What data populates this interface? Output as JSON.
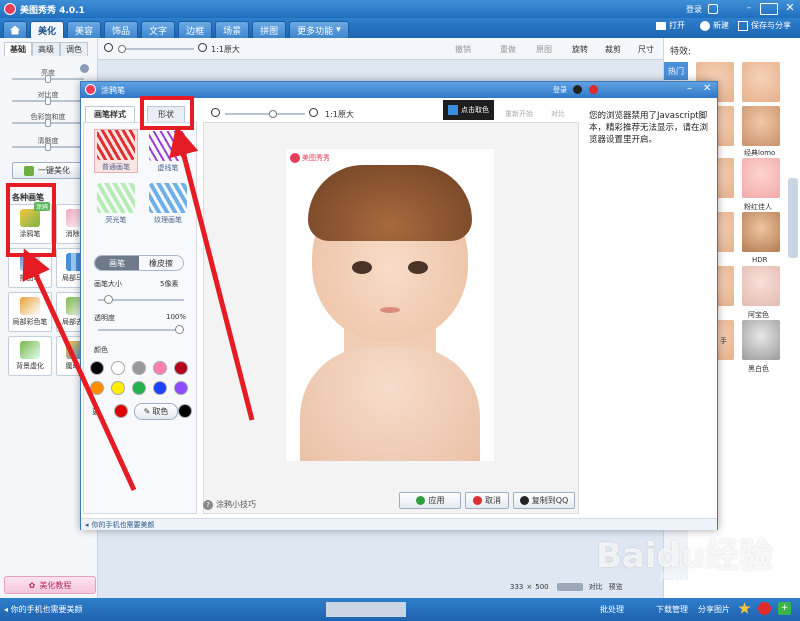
{
  "app": {
    "title": "美图秀秀 4.0.1",
    "login": "登录"
  },
  "menu": {
    "home_icon": "home-icon",
    "tabs": [
      "美化",
      "美容",
      "饰品",
      "文字",
      "边框",
      "场景",
      "拼图"
    ],
    "more": "更多功能"
  },
  "top_actions": {
    "open": "打开",
    "new": "新建",
    "save_share": "保存与分享"
  },
  "toolbar": {
    "zoom_actual": "1:1原大",
    "undo": "撤销",
    "redo": "重做",
    "original": "原图",
    "rotate": "旋转",
    "crop": "裁剪",
    "size": "尺寸"
  },
  "left_panel": {
    "tabs": [
      "基础",
      "高级",
      "调色"
    ],
    "sliders": [
      "亮度",
      "对比度",
      "色彩饱和度",
      "清晰度"
    ],
    "one_click": "一键美化",
    "brush_section": "各种画笔",
    "brush_badge": "涂鸦",
    "tools": [
      "涂鸦笔",
      "消除笔",
      "抠图笔",
      "局部马赛",
      "局部彩色笔",
      "局部去色",
      "背景虚化",
      "魔幻笔"
    ],
    "tutorial": "美化教程"
  },
  "dialog": {
    "title": "涂鸦笔",
    "login": "登录",
    "tabs": [
      "画笔样式",
      "形状"
    ],
    "zoom_actual": "1:1原大",
    "pick_color_tip": "点击取色",
    "restart": "重新开始",
    "compare": "对比",
    "brushes": [
      "普通画笔",
      "虚线笔",
      "荧光笔",
      "纹理画笔"
    ],
    "mode_tabs": [
      "画笔",
      "橡皮擦"
    ],
    "brush_size_label": "画笔大小",
    "brush_size_value": "5像素",
    "brush_size_frac": 0.08,
    "opacity_label": "透明度",
    "opacity_value": "100%",
    "opacity_frac": 1.0,
    "color_label": "颜色",
    "colors": [
      "#000000",
      "#ffffff",
      "#999999",
      "#ff7eb0",
      "#b3001b",
      "#ff8c00",
      "#ffee00",
      "#22b14c",
      "#1e40ff",
      "#8b4dff"
    ],
    "more_label": "更",
    "custom_color": "#e00000",
    "pick_label": "取色",
    "pick_color": "#000000",
    "watermark": "美图秀秀",
    "browser_notice": "您的浏览器禁用了Javascript脚本，精彩推荐无法显示，请在浏览器设置里开启。",
    "tips": "涂鸦小技巧",
    "apply": "应用",
    "cancel": "取消",
    "copy_to_qq": "复制到QQ",
    "footer_notice": "你的手机也需要美颜"
  },
  "right_panel": {
    "title": "特效:",
    "tab_hot": "热门",
    "effects": [
      "经典lomo",
      "粉红佳人",
      "HDR",
      "阿宝色",
      "黑白色"
    ],
    "side_label": "手"
  },
  "canvas_info": {
    "width": "333",
    "x": "×",
    "height": "500",
    "compare": "对比",
    "preview": "预览"
  },
  "status": {
    "notice": "你的手机也需要美颜",
    "batch": "批处理",
    "download": "下载管理",
    "share": "分享图片"
  },
  "watermark": "Baidu经验",
  "watermark_url": "jingyan.baidu.com"
}
